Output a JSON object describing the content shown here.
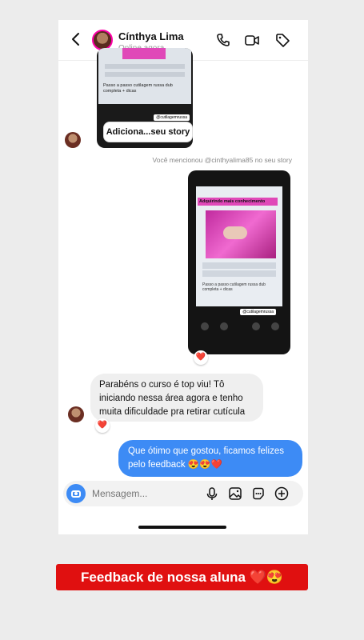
{
  "header": {
    "name": "Cínthya Lima",
    "status": "Online agora"
  },
  "story_reply": {
    "thumb_text": "Passo a passo cutilagem russa dub completa + dicas",
    "thumb_tag": "@cutilagemrussa",
    "caption": "Adiciona...seu story"
  },
  "mention_text": "Você mencionou @cinthyalima85 no seu story",
  "shared_story": {
    "title": "Adquirindo mais conhecimento",
    "text": "Passo a passo cutilagem russa dub completa + dicas",
    "tag": "@cutilagemrussa",
    "reaction": "❤️"
  },
  "messages": {
    "incoming": "Parabéns o curso é top viu! Tô iniciando nessa área agora e tenho muita dificuldade  pra retirar cutícula",
    "incoming_reaction": "❤️",
    "outgoing": "Que ótimo que gostou, ficamos felizes pelo feedback 😍😍❤️"
  },
  "composer": {
    "placeholder": "Mensagem..."
  },
  "banner": "Feedback de nossa aluna ❤️😍",
  "icons": [
    "back-icon",
    "phone-icon",
    "video-icon",
    "tag-icon",
    "camera-icon",
    "mic-icon",
    "gallery-icon",
    "sticker-icon",
    "plus-icon",
    "heart-icon"
  ],
  "colors": {
    "outgoing_bubble": "#3d8bf5",
    "banner": "#e01010",
    "accent_pink": "#e048b8"
  }
}
